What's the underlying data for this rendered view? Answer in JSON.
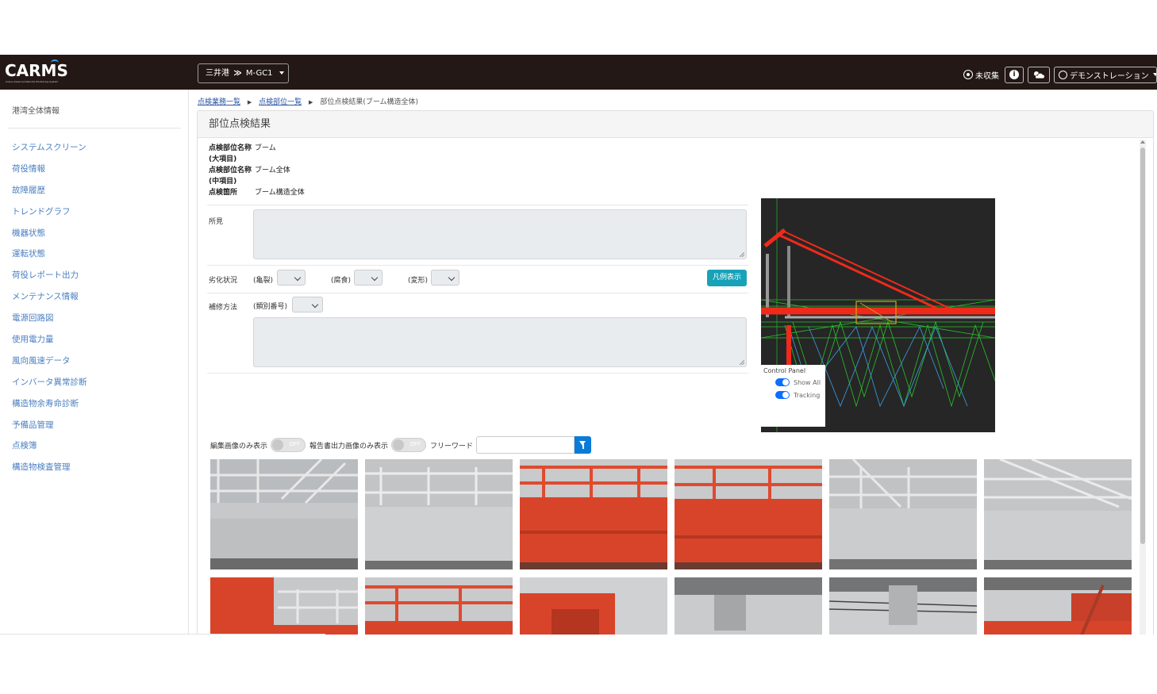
{
  "app": {
    "logo_text": "CARMS",
    "logo_subtitle": "Crane Advanced Remote Monitoring System",
    "port_selector": {
      "port": "三井港",
      "separator": "≫",
      "crane": "M-GC1"
    },
    "uncollected_label": "未収集",
    "user_label": "デモンストレーション"
  },
  "sidebar": {
    "top_item": "港湾全体情報",
    "items": [
      "システムスクリーン",
      "荷役情報",
      "故障履歴",
      "トレンドグラフ",
      "機器状態",
      "運転状態",
      "荷役レポート出力",
      "メンテナンス情報",
      "電源回路図",
      "使用電力量",
      "風向風速データ",
      "インバータ異常診断",
      "構造物余寿命診断",
      "予備品管理",
      "点検簿",
      "構造物検査管理"
    ]
  },
  "breadcrumb": {
    "link1": "点検業務一覧",
    "link2": "点検部位一覧",
    "current": "部位点検結果(ブーム構造全体)"
  },
  "card": {
    "title": "部位点検結果",
    "info": {
      "major_key": "点検部位名称(大項目)",
      "major_key_a": "点検部位名称",
      "major_key_b": "(大項目)",
      "major_value": "ブーム",
      "mid_key_a": "点検部位名称",
      "mid_key_b": "(中項目)",
      "mid_value": "ブーム全体",
      "place_key": "点検箇所",
      "place_value": "ブーム構造全体"
    },
    "findings_label": "所見",
    "degradation": {
      "label": "劣化状況",
      "crack": "(亀裂)",
      "corrosion": "(腐食)",
      "deformation": "(変形)"
    },
    "legend_button": "凡例表示",
    "repair": {
      "label": "補修方法",
      "category": "(類別番号)"
    },
    "filters": {
      "edited_only": "編集画像のみ表示",
      "report_only": "報告書出力画像のみ表示",
      "toggle_off": "OFF",
      "freeword": "フリーワード"
    },
    "control_panel": {
      "title": "Control Panel",
      "show_all": "Show All",
      "tracking": "Tracking"
    }
  },
  "colors": {
    "topbar": "#231815",
    "link": "#4a7fc1",
    "legend_button": "#17a2b8",
    "filter_button": "#0b7bd8",
    "crane_red": "#d8442a"
  }
}
